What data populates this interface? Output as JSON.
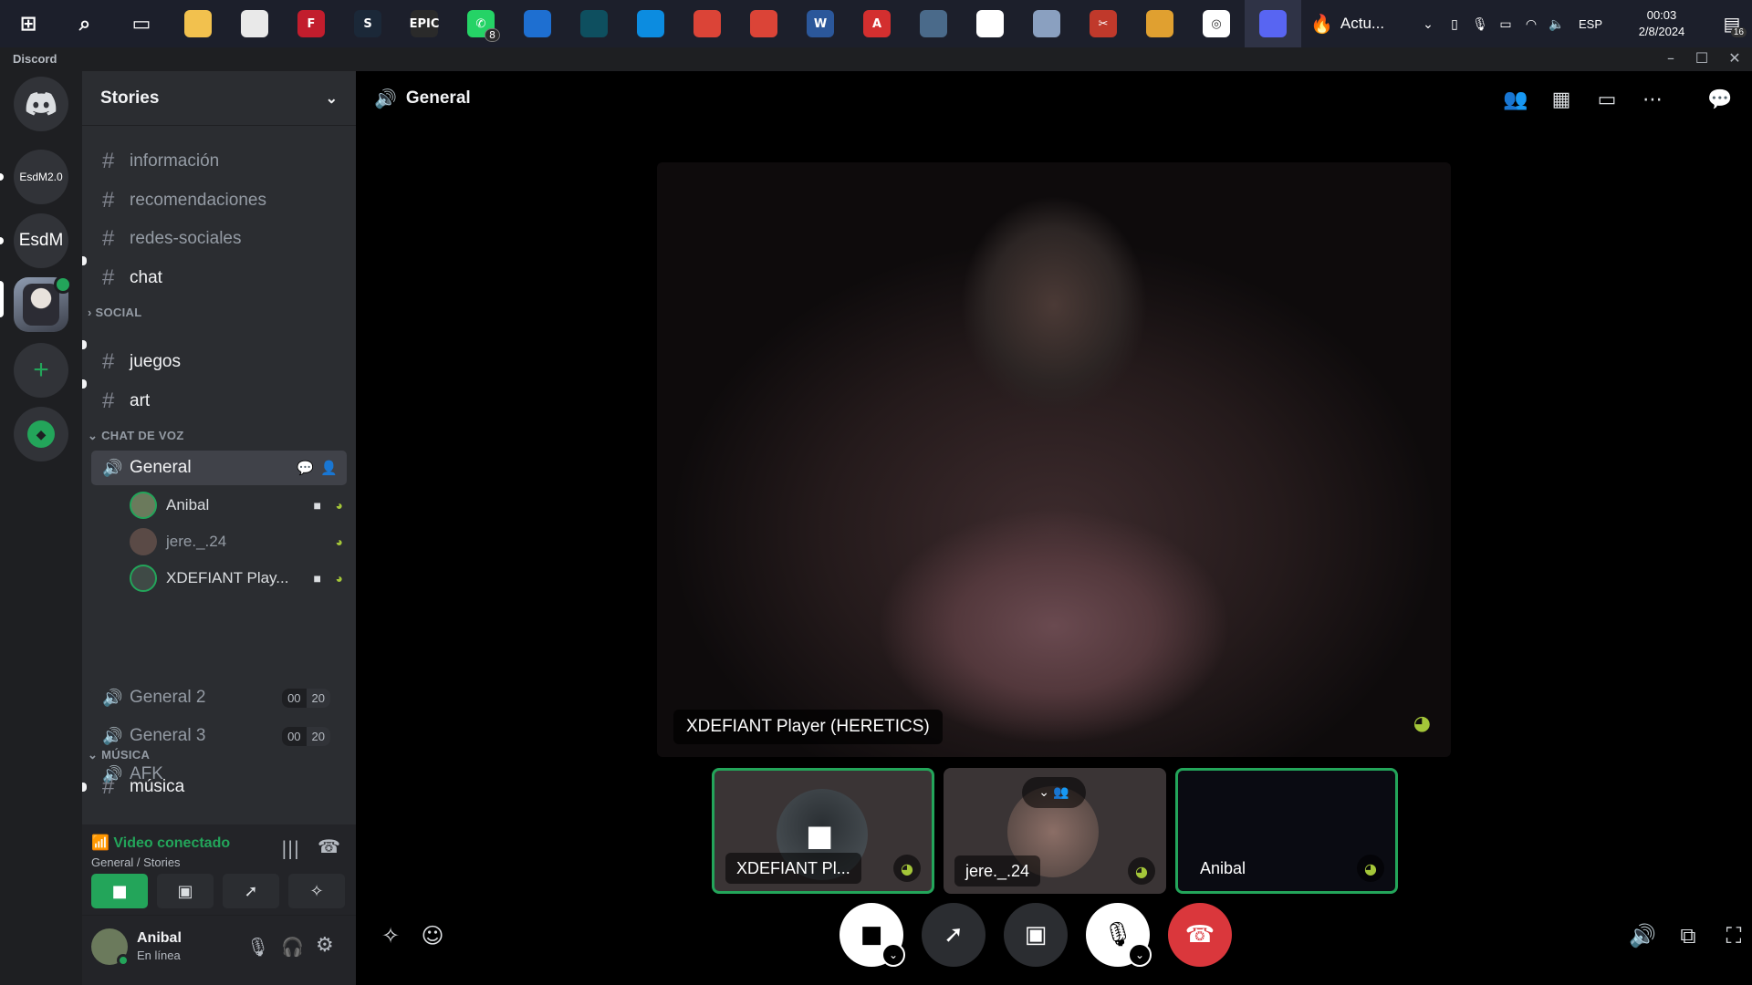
{
  "taskbar": {
    "apps": [
      {
        "name": "windows-start-icon",
        "glyph": "⊞",
        "color": "#ffffff"
      },
      {
        "name": "search-icon",
        "glyph": "⌕",
        "color": "#ffffff"
      },
      {
        "name": "task-view-icon",
        "glyph": "▭",
        "color": "#ffffff"
      },
      {
        "name": "file-explorer-icon",
        "glyph": "",
        "color": "#f2c14e"
      },
      {
        "name": "ms-store-icon",
        "glyph": "",
        "color": "#e9e9e9"
      },
      {
        "name": "fl-app-icon",
        "glyph": "F",
        "color": "#c21d2d"
      },
      {
        "name": "steam-icon",
        "glyph": "S",
        "color": "#1b2838"
      },
      {
        "name": "epic-games-icon",
        "glyph": "EPIC",
        "color": "#2a2a2a"
      },
      {
        "name": "whatsapp-icon",
        "glyph": "✆",
        "color": "#25d366"
      },
      {
        "name": "app-blue-icon",
        "glyph": "",
        "color": "#1e6fd1"
      },
      {
        "name": "app-teal-icon",
        "glyph": "",
        "color": "#0e4f5f"
      },
      {
        "name": "edge-icon",
        "glyph": "",
        "color": "#0c8ce0"
      },
      {
        "name": "chrome-icon",
        "glyph": "",
        "color": "#db4437"
      },
      {
        "name": "chrome-profile-icon",
        "glyph": "",
        "color": "#db4437"
      },
      {
        "name": "word-icon",
        "glyph": "W",
        "color": "#2b579a"
      },
      {
        "name": "autocad-icon",
        "glyph": "A",
        "color": "#d32f2f"
      },
      {
        "name": "calculator-icon",
        "glyph": "",
        "color": "#4a6a8a"
      },
      {
        "name": "paint-icon",
        "glyph": "",
        "color": "#ffffff"
      },
      {
        "name": "app-jellyfish-icon",
        "glyph": "",
        "color": "#8aa0c0"
      },
      {
        "name": "app-scissors-icon",
        "glyph": "✂",
        "color": "#c0392b"
      },
      {
        "name": "app-creature-icon",
        "glyph": "",
        "color": "#e0a030"
      },
      {
        "name": "app-spiral-icon",
        "glyph": "◎",
        "color": "#ffffff"
      },
      {
        "name": "discord-taskbar-icon",
        "glyph": "",
        "color": "#5865f2"
      }
    ],
    "whatsapp_badge": "8",
    "weather_label": "Actu...",
    "language": "ESP",
    "time": "00:03",
    "date": "2/8/2024",
    "notification_count": "16"
  },
  "window": {
    "title": "Discord"
  },
  "servers": [
    {
      "label": "",
      "name": "discord-home-icon"
    },
    {
      "label": "EsdM2.0",
      "name": "server-esdm20"
    },
    {
      "label": "EsdM",
      "name": "server-esdm"
    },
    {
      "label": "",
      "name": "server-stories"
    },
    {
      "label": "+",
      "name": "add-server-icon"
    },
    {
      "label": "",
      "name": "discover-icon"
    }
  ],
  "guild": {
    "name": "Stories"
  },
  "channels_top": [
    {
      "label": "información",
      "unread": false
    },
    {
      "label": "recomendaciones",
      "unread": false
    },
    {
      "label": "redes-sociales",
      "unread": false
    },
    {
      "label": "chat",
      "unread": true
    }
  ],
  "categories": {
    "social": "SOCIAL",
    "voice": "CHAT DE VOZ",
    "music": "MÚSICA"
  },
  "channels_social": [
    {
      "label": "juegos",
      "unread": true
    },
    {
      "label": "art",
      "unread": true
    }
  ],
  "voice_channels": {
    "general": "General",
    "general2": "General 2",
    "general3": "General 3",
    "afk": "AFK",
    "general2_count": [
      "00",
      "20"
    ],
    "general3_count": [
      "00",
      "20"
    ]
  },
  "voice_users": [
    {
      "name": "Anibal"
    },
    {
      "name": "jere._.24"
    },
    {
      "name": "XDEFIANT Play..."
    }
  ],
  "music_channels": [
    {
      "label": "música",
      "unread": true
    }
  ],
  "voice_panel": {
    "status": "Video conectado",
    "location": "General / Stories"
  },
  "user": {
    "name": "Anibal",
    "status": "En línea"
  },
  "main": {
    "channel_title": "General",
    "focused_name": "XDEFIANT Player (HERETICS)",
    "tiles": [
      {
        "name": "XDEFIANT Pl...",
        "speaking": true
      },
      {
        "name": "jere._.24",
        "speaking": false
      },
      {
        "name": "Anibal",
        "speaking": true
      }
    ]
  },
  "colors": {
    "accent_green": "#23a55a",
    "blurple": "#5865f2",
    "danger_red": "#da373c"
  }
}
